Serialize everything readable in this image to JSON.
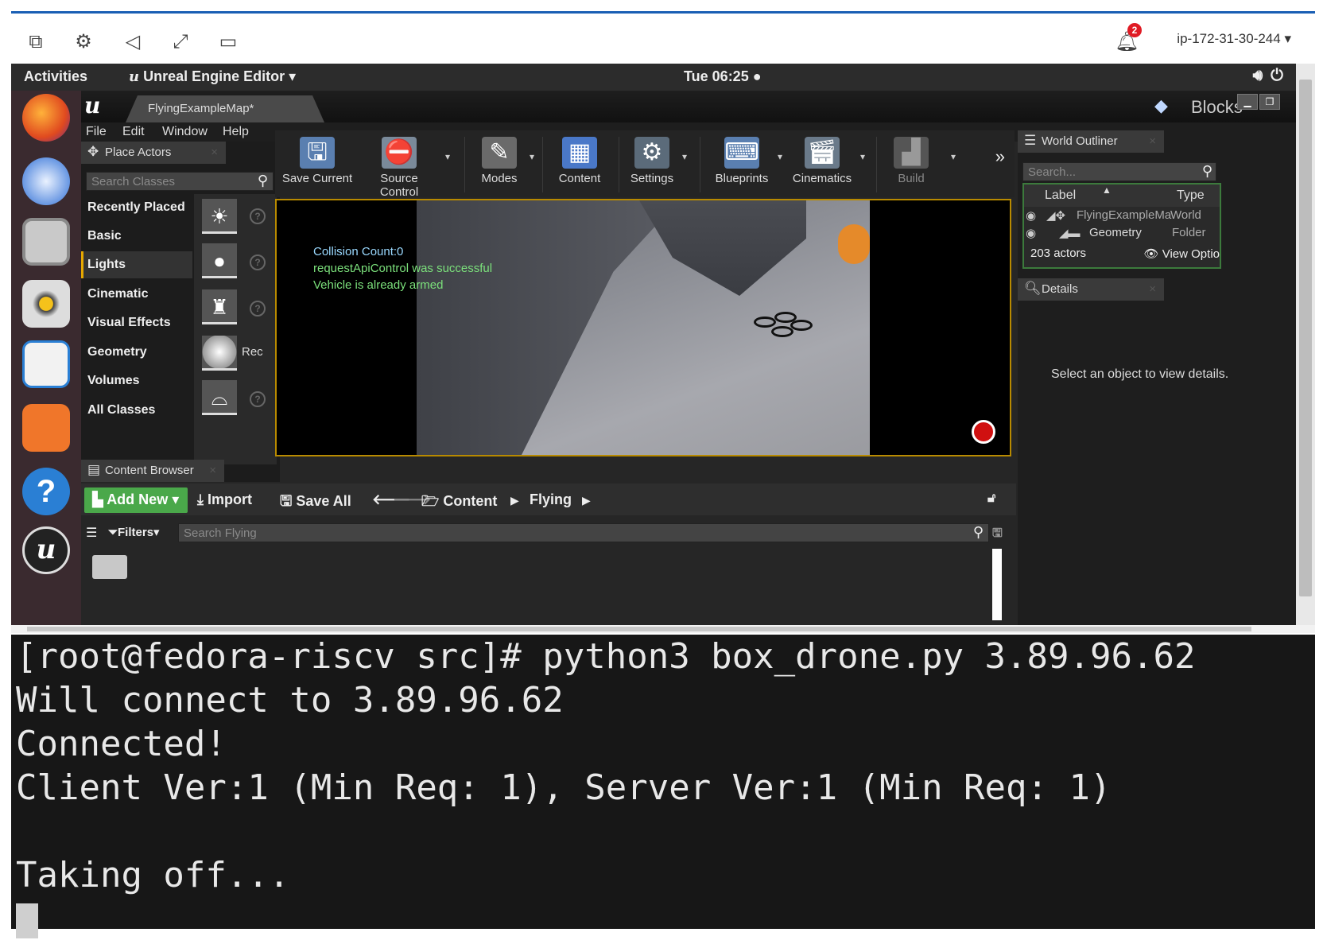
{
  "remote_bar": {
    "host": "ip-172-31-30-244",
    "notification_count": "2",
    "icons": [
      "copy-icon",
      "gear-icon",
      "volume-icon",
      "fullscreen-icon",
      "display-icon"
    ]
  },
  "ubuntu": {
    "activities": "Activities",
    "app_menu": "Unreal Engine Editor",
    "clock": "Tue 06:25 ●",
    "dock": [
      "firefox-icon",
      "thunderbird-icon",
      "files-icon",
      "rhythmbox-icon",
      "writer-icon",
      "software-icon",
      "help-icon",
      "unreal-icon"
    ]
  },
  "ue": {
    "tab": "FlyingExampleMap*",
    "project": "Blocks",
    "menu": [
      "File",
      "Edit",
      "Window",
      "Help"
    ],
    "place_actors": {
      "title": "Place Actors",
      "search_placeholder": "Search Classes",
      "categories": [
        "Recently Placed",
        "Basic",
        "Lights",
        "Cinematic",
        "Visual Effects",
        "Geometry",
        "Volumes",
        "All Classes"
      ],
      "selected": "Lights",
      "rec_label": "Rec"
    },
    "toolbar": {
      "save_current": "Save Current",
      "source_control": "Source Control",
      "modes": "Modes",
      "content": "Content",
      "settings": "Settings",
      "blueprints": "Blueprints",
      "cinematics": "Cinematics",
      "build": "Build"
    },
    "viewport": {
      "hud": [
        "Collision Count:0",
        "requestApiControl was successful",
        "Vehicle is already armed"
      ]
    },
    "content_browser": {
      "title": "Content Browser",
      "add_new": "Add New",
      "import": "Import",
      "save_all": "Save All",
      "path": [
        "Content",
        "Flying"
      ],
      "filters": "Filters",
      "search_placeholder": "Search Flying"
    },
    "world_outliner": {
      "title": "World Outliner",
      "search_placeholder": "Search...",
      "col_label": "Label",
      "col_type": "Type",
      "rows": [
        {
          "label": "FlyingExampleMa",
          "type": "World"
        },
        {
          "label": "Geometry",
          "type": "Folder"
        }
      ],
      "count": "203 actors",
      "view_options": "View Optio"
    },
    "details": {
      "title": "Details",
      "empty_msg": "Select an object to view details."
    }
  },
  "terminal": {
    "lines": [
      "[root@fedora-riscv src]# python3 box_drone.py 3.89.96.62",
      "Will connect to 3.89.96.62",
      "Connected!",
      "Client Ver:1 (Min Req: 1), Server Ver:1 (Min Req: 1)",
      "",
      "Taking off..."
    ]
  },
  "colors": {
    "add_new_green": "#4aa84a",
    "selected_cat_accent": "#e6a800",
    "viewport_border": "#b88a00",
    "terminal_bg": "#171717",
    "hud_green": "#7be07b"
  }
}
